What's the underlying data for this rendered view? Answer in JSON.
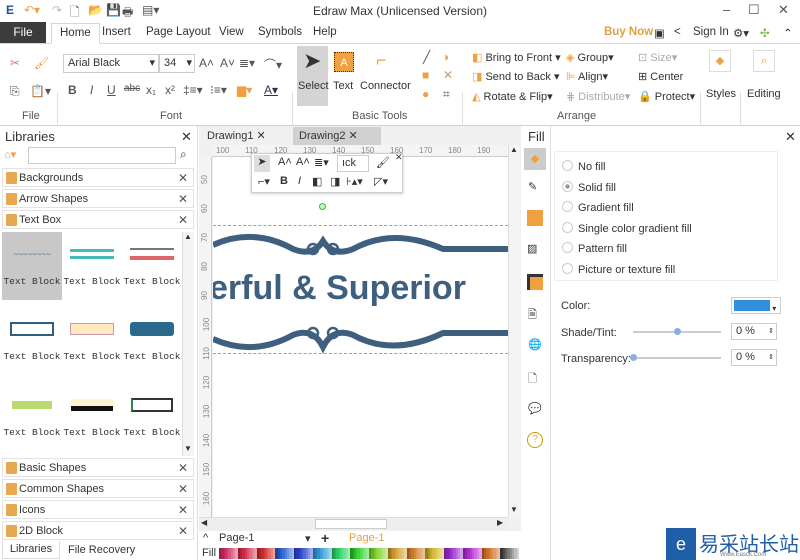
{
  "app": {
    "title": "Edraw Max (Unlicensed Version)"
  },
  "window": {
    "minimize": "–",
    "maximize": "☐",
    "close": "✕"
  },
  "menu": {
    "file": "File",
    "tabs": [
      "Home",
      "Insert",
      "Page Layout",
      "View",
      "Symbols",
      "Help"
    ],
    "buy_now": "Buy Now",
    "sign_in": "Sign In"
  },
  "ribbon": {
    "file_group": "File",
    "font_group": "Font",
    "font_name": "Arial Black",
    "font_size": "34",
    "basic_tools_group": "Basic Tools",
    "select": "Select",
    "text": "Text",
    "connector": "Connector",
    "arrange_group": "Arrange",
    "bring_to_front": "Bring to Front",
    "send_to_back": "Send to Back",
    "rotate_flip": "Rotate & Flip",
    "group": "Group",
    "align": "Align",
    "distribute": "Distribute",
    "size": "Size",
    "center": "Center",
    "protect": "Protect",
    "styles": "Styles",
    "editing": "Editing"
  },
  "libraries": {
    "title": "Libraries",
    "search_placeholder": "",
    "top_items": [
      "Backgrounds",
      "Arrow Shapes",
      "Text Box"
    ],
    "grid_label": "Text Block",
    "bottom_items": [
      "Basic Shapes",
      "Common Shapes",
      "Icons",
      "2D Block"
    ],
    "tabs": [
      "Libraries",
      "File Recovery"
    ]
  },
  "canvas": {
    "tabs": [
      "Drawing1",
      "Drawing2"
    ],
    "hruler": [
      "100",
      "110",
      "120",
      "130",
      "140",
      "150",
      "160",
      "170",
      "180",
      "190"
    ],
    "vruler": [
      "50",
      "60",
      "70",
      "80",
      "90",
      "100",
      "110",
      "120",
      "130",
      "140",
      "150",
      "160"
    ],
    "text": "erful & Superior",
    "mini_font": "ıck",
    "text_color": "#3f5f7f",
    "page_select": "Page-1",
    "page_tab": "Page-1",
    "fill_label": "Fill"
  },
  "fill_panel": {
    "title": "Fill",
    "options": [
      "No fill",
      "Solid fill",
      "Gradient fill",
      "Single color gradient fill",
      "Pattern fill",
      "Picture or texture fill"
    ],
    "selected": "Solid fill",
    "color_label": "Color:",
    "color": "#2f8fdc",
    "shade_label": "Shade/Tint:",
    "shade_value": "0 %",
    "shade_slider": 0.5,
    "transparency_label": "Transparency:",
    "transparency_value": "0 %",
    "transparency_slider": 0
  },
  "watermark": {
    "text": "易采站长站",
    "url_text": "Www.Easck.Com"
  }
}
